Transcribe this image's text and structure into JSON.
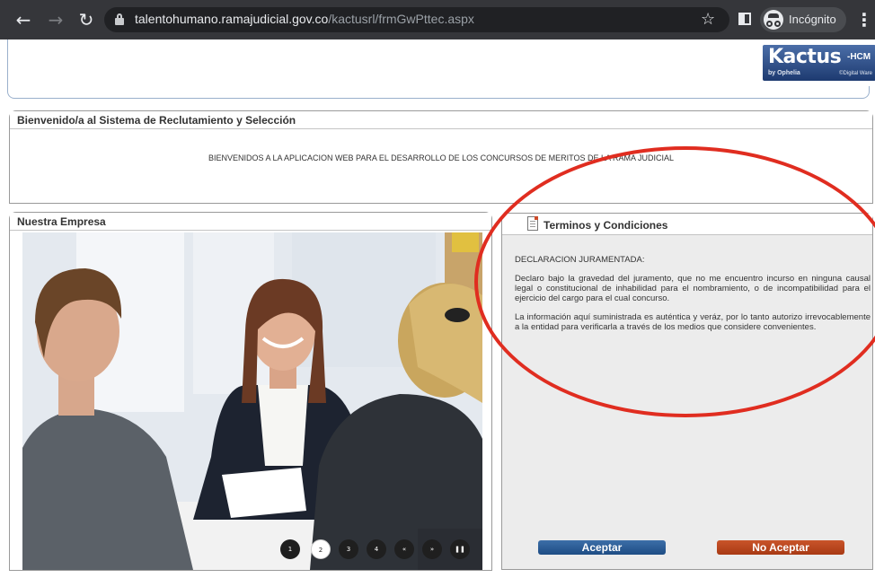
{
  "browser": {
    "url_host": "talentohumano.ramajudicial.gov.co",
    "url_path": "/kactusrl/frmGwPttec.aspx",
    "incognito_label": "Incógnito"
  },
  "logo": {
    "main": "Kactus",
    "suffix": "-HCM",
    "byline": "by Ophelia",
    "maker": "©Digital Ware"
  },
  "welcome": {
    "title": "Bienvenido/a al Sistema de Reclutamiento y Selección",
    "message": "BIENVENIDOS A LA APLICACION WEB PARA EL DESARROLLO DE LOS CONCURSOS DE MERITOS DE LA RAMA JUDICIAL"
  },
  "empresa": {
    "title": "Nuestra Empresa",
    "carousel": [
      "1",
      "2",
      "3",
      "4",
      "«",
      "»",
      "❚❚"
    ],
    "active_slide": 2
  },
  "terms": {
    "title": "Terminos y Condiciones",
    "heading": "DECLARACION JURAMENTADA:",
    "paragraph1": "Declaro bajo la gravedad del juramento, que no me encuentro incurso en ninguna causal legal o constitucional de inhabilidad para el nombramiento, o de incompatibilidad para el ejercicio del cargo para el cual concurso.",
    "paragraph2": "La información aquí suministrada es auténtica y veráz, por lo tanto autorizo irrevocablemente a la entidad para verificarla a través de los medios que considere convenientes.",
    "accept_label": "Aceptar",
    "reject_label": "No Aceptar"
  },
  "colors": {
    "accent_blue": "#1e4d84",
    "reject_orange": "#a83a14",
    "annotation_red": "#e02d20"
  }
}
